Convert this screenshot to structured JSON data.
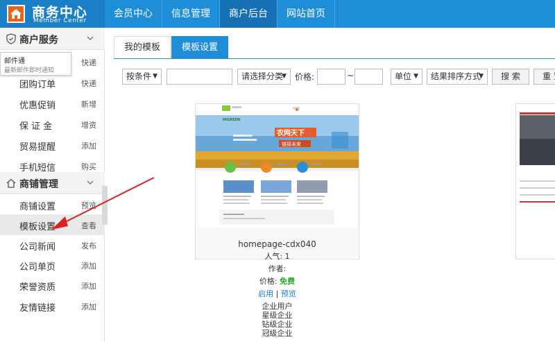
{
  "header": {
    "logo_title": "商务中心",
    "logo_subtitle": "Member Center",
    "nav": [
      {
        "label": "会员中心",
        "active": false
      },
      {
        "label": "信息管理",
        "active": false
      },
      {
        "label": "商户后台",
        "active": true
      },
      {
        "label": "网站首页",
        "active": false
      }
    ]
  },
  "sidebar": {
    "section1_title": "商户服务",
    "tooltip_title": "邮件通",
    "tooltip_desc": "最新邮件即时通知",
    "section1_items": [
      {
        "label": "",
        "action": "快递"
      },
      {
        "label": "团购订单",
        "action": "快递"
      },
      {
        "label": "优惠促销",
        "action": "新增"
      },
      {
        "label": "保 证 金",
        "action": "增资"
      },
      {
        "label": "贸易提醒",
        "action": "添加"
      },
      {
        "label": "手机短信",
        "action": "购买"
      }
    ],
    "section2_title": "商铺管理",
    "section2_items": [
      {
        "label": "商铺设置",
        "action": "预览"
      },
      {
        "label": "模板设置",
        "action": "查看"
      },
      {
        "label": "公司新闻",
        "action": "发布"
      },
      {
        "label": "公司单页",
        "action": "添加"
      },
      {
        "label": "荣誉资质",
        "action": "添加"
      },
      {
        "label": "友情链接",
        "action": "添加"
      }
    ]
  },
  "main": {
    "tabs": [
      {
        "label": "我的模板",
        "active": false
      },
      {
        "label": "模板设置",
        "active": true
      }
    ],
    "filters": {
      "condition": "按条件",
      "category": "请选择分类",
      "price_label": "价格:",
      "price_sep": "~",
      "unit": "单位",
      "sort": "结果排序方式",
      "search": "搜 索",
      "reset": "重 置"
    },
    "template": {
      "name": "homepage-cdx040",
      "popularity": "人气: 1",
      "author": "作者:",
      "price_label": "价格:",
      "price_value": "免费",
      "enable": "启用",
      "separator": "|",
      "preview": "预览",
      "levels": [
        "企业用户",
        "星级企业",
        "钻级企业",
        "冠级企业"
      ],
      "thumb_banner_line1": "农网天下",
      "thumb_banner_line2": "链接未来",
      "thumb_brand": "HIGREEN"
    }
  },
  "colors": {
    "primary": "#1e8ed9",
    "nav_active": "#1570b4",
    "free_green": "#28a62e",
    "link_blue": "#1e7ec8",
    "arrow_red": "#e02020",
    "logo_orange": "#e8641b"
  }
}
